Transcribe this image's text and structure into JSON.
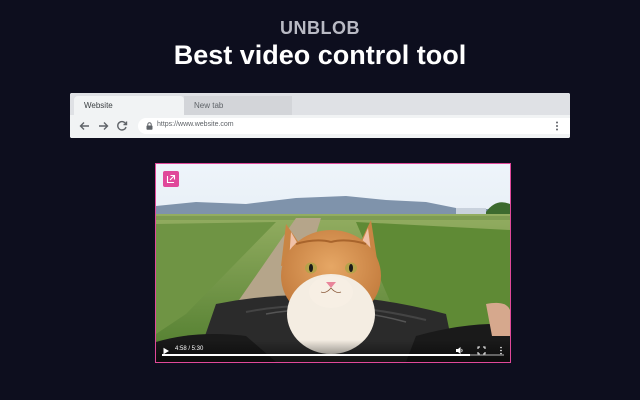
{
  "brand": "UNBLOB",
  "headline": "Best video control tool",
  "browser": {
    "tabs": [
      {
        "label": "Website",
        "active": true
      },
      {
        "label": "New tab",
        "active": false
      }
    ],
    "url": "https://www.website.com",
    "icons": {
      "back": "arrow-left-icon",
      "forward": "arrow-right-icon",
      "reload": "reload-icon",
      "lock": "lock-icon",
      "menu": "kebab-menu-icon"
    }
  },
  "video": {
    "time": "4:58 / 5:30",
    "progress": 0.9,
    "accent": "#e0489a",
    "icons": {
      "pip": "external-open-icon",
      "play": "play-icon",
      "volume": "volume-icon",
      "fullscreen": "fullscreen-icon",
      "more": "more-vertical-icon"
    }
  }
}
